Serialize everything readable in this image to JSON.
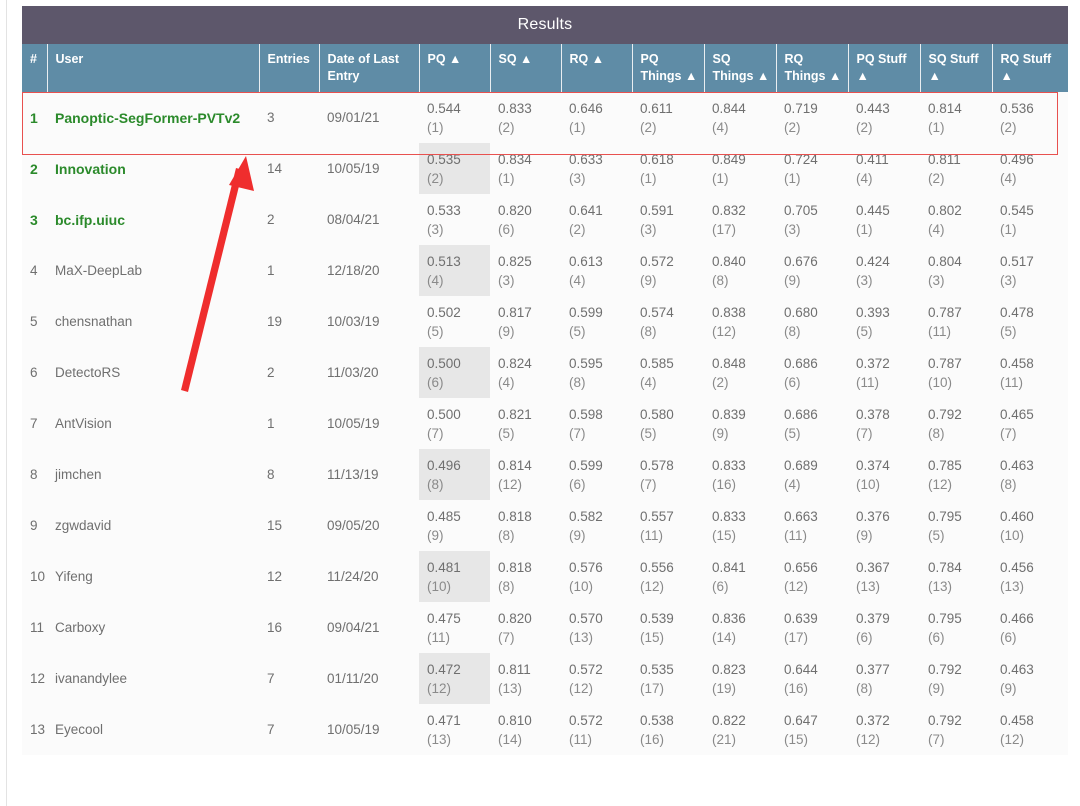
{
  "panel": {
    "title": "Results"
  },
  "table": {
    "columns": [
      {
        "key": "rank",
        "label": "#",
        "sort": ""
      },
      {
        "key": "user",
        "label": "User",
        "sort": ""
      },
      {
        "key": "entries",
        "label": "Entries",
        "sort": ""
      },
      {
        "key": "date",
        "label": "Date of Last Entry",
        "sort": ""
      },
      {
        "key": "pq",
        "label": "PQ",
        "sort": "▲"
      },
      {
        "key": "sq",
        "label": "SQ",
        "sort": "▲"
      },
      {
        "key": "rq",
        "label": "RQ",
        "sort": "▲"
      },
      {
        "key": "pq_things",
        "label": "PQ Things",
        "sort": "▲"
      },
      {
        "key": "sq_things",
        "label": "SQ Things",
        "sort": "▲"
      },
      {
        "key": "rq_things",
        "label": "RQ Things",
        "sort": "▲"
      },
      {
        "key": "pq_stuff",
        "label": "PQ Stuff",
        "sort": "▲"
      },
      {
        "key": "sq_stuff",
        "label": "SQ Stuff",
        "sort": "▲"
      },
      {
        "key": "rq_stuff",
        "label": "RQ Stuff",
        "sort": "▲"
      }
    ],
    "rows": [
      {
        "rank": "1",
        "user": "Panoptic-SegFormer-PVTv2",
        "entries": "3",
        "date": "09/01/21",
        "metrics": [
          {
            "value": "0.544",
            "rank": "(1)"
          },
          {
            "value": "0.833",
            "rank": "(2)"
          },
          {
            "value": "0.646",
            "rank": "(1)"
          },
          {
            "value": "0.611",
            "rank": "(2)"
          },
          {
            "value": "0.844",
            "rank": "(4)"
          },
          {
            "value": "0.719",
            "rank": "(2)"
          },
          {
            "value": "0.443",
            "rank": "(2)"
          },
          {
            "value": "0.814",
            "rank": "(1)"
          },
          {
            "value": "0.536",
            "rank": "(2)"
          }
        ]
      },
      {
        "rank": "2",
        "user": "Innovation",
        "entries": "14",
        "date": "10/05/19",
        "metrics": [
          {
            "value": "0.535",
            "rank": "(2)"
          },
          {
            "value": "0.834",
            "rank": "(1)"
          },
          {
            "value": "0.633",
            "rank": "(3)"
          },
          {
            "value": "0.618",
            "rank": "(1)"
          },
          {
            "value": "0.849",
            "rank": "(1)"
          },
          {
            "value": "0.724",
            "rank": "(1)"
          },
          {
            "value": "0.411",
            "rank": "(4)"
          },
          {
            "value": "0.811",
            "rank": "(2)"
          },
          {
            "value": "0.496",
            "rank": "(4)"
          }
        ]
      },
      {
        "rank": "3",
        "user": "bc.ifp.uiuc",
        "entries": "2",
        "date": "08/04/21",
        "metrics": [
          {
            "value": "0.533",
            "rank": "(3)"
          },
          {
            "value": "0.820",
            "rank": "(6)"
          },
          {
            "value": "0.641",
            "rank": "(2)"
          },
          {
            "value": "0.591",
            "rank": "(3)"
          },
          {
            "value": "0.832",
            "rank": "(17)"
          },
          {
            "value": "0.705",
            "rank": "(3)"
          },
          {
            "value": "0.445",
            "rank": "(1)"
          },
          {
            "value": "0.802",
            "rank": "(4)"
          },
          {
            "value": "0.545",
            "rank": "(1)"
          }
        ]
      },
      {
        "rank": "4",
        "user": "MaX-DeepLab",
        "entries": "1",
        "date": "12/18/20",
        "metrics": [
          {
            "value": "0.513",
            "rank": "(4)"
          },
          {
            "value": "0.825",
            "rank": "(3)"
          },
          {
            "value": "0.613",
            "rank": "(4)"
          },
          {
            "value": "0.572",
            "rank": "(9)"
          },
          {
            "value": "0.840",
            "rank": "(8)"
          },
          {
            "value": "0.676",
            "rank": "(9)"
          },
          {
            "value": "0.424",
            "rank": "(3)"
          },
          {
            "value": "0.804",
            "rank": "(3)"
          },
          {
            "value": "0.517",
            "rank": "(3)"
          }
        ]
      },
      {
        "rank": "5",
        "user": "chensnathan",
        "entries": "19",
        "date": "10/03/19",
        "metrics": [
          {
            "value": "0.502",
            "rank": "(5)"
          },
          {
            "value": "0.817",
            "rank": "(9)"
          },
          {
            "value": "0.599",
            "rank": "(5)"
          },
          {
            "value": "0.574",
            "rank": "(8)"
          },
          {
            "value": "0.838",
            "rank": "(12)"
          },
          {
            "value": "0.680",
            "rank": "(8)"
          },
          {
            "value": "0.393",
            "rank": "(5)"
          },
          {
            "value": "0.787",
            "rank": "(11)"
          },
          {
            "value": "0.478",
            "rank": "(5)"
          }
        ]
      },
      {
        "rank": "6",
        "user": "DetectoRS",
        "entries": "2",
        "date": "11/03/20",
        "metrics": [
          {
            "value": "0.500",
            "rank": "(6)"
          },
          {
            "value": "0.824",
            "rank": "(4)"
          },
          {
            "value": "0.595",
            "rank": "(8)"
          },
          {
            "value": "0.585",
            "rank": "(4)"
          },
          {
            "value": "0.848",
            "rank": "(2)"
          },
          {
            "value": "0.686",
            "rank": "(6)"
          },
          {
            "value": "0.372",
            "rank": "(11)"
          },
          {
            "value": "0.787",
            "rank": "(10)"
          },
          {
            "value": "0.458",
            "rank": "(11)"
          }
        ]
      },
      {
        "rank": "7",
        "user": "AntVision",
        "entries": "1",
        "date": "10/05/19",
        "metrics": [
          {
            "value": "0.500",
            "rank": "(7)"
          },
          {
            "value": "0.821",
            "rank": "(5)"
          },
          {
            "value": "0.598",
            "rank": "(7)"
          },
          {
            "value": "0.580",
            "rank": "(5)"
          },
          {
            "value": "0.839",
            "rank": "(9)"
          },
          {
            "value": "0.686",
            "rank": "(5)"
          },
          {
            "value": "0.378",
            "rank": "(7)"
          },
          {
            "value": "0.792",
            "rank": "(8)"
          },
          {
            "value": "0.465",
            "rank": "(7)"
          }
        ]
      },
      {
        "rank": "8",
        "user": "jimchen",
        "entries": "8",
        "date": "11/13/19",
        "metrics": [
          {
            "value": "0.496",
            "rank": "(8)"
          },
          {
            "value": "0.814",
            "rank": "(12)"
          },
          {
            "value": "0.599",
            "rank": "(6)"
          },
          {
            "value": "0.578",
            "rank": "(7)"
          },
          {
            "value": "0.833",
            "rank": "(16)"
          },
          {
            "value": "0.689",
            "rank": "(4)"
          },
          {
            "value": "0.374",
            "rank": "(10)"
          },
          {
            "value": "0.785",
            "rank": "(12)"
          },
          {
            "value": "0.463",
            "rank": "(8)"
          }
        ]
      },
      {
        "rank": "9",
        "user": "zgwdavid",
        "entries": "15",
        "date": "09/05/20",
        "metrics": [
          {
            "value": "0.485",
            "rank": "(9)"
          },
          {
            "value": "0.818",
            "rank": "(8)"
          },
          {
            "value": "0.582",
            "rank": "(9)"
          },
          {
            "value": "0.557",
            "rank": "(11)"
          },
          {
            "value": "0.833",
            "rank": "(15)"
          },
          {
            "value": "0.663",
            "rank": "(11)"
          },
          {
            "value": "0.376",
            "rank": "(9)"
          },
          {
            "value": "0.795",
            "rank": "(5)"
          },
          {
            "value": "0.460",
            "rank": "(10)"
          }
        ]
      },
      {
        "rank": "10",
        "user": "Yifeng",
        "entries": "12",
        "date": "11/24/20",
        "metrics": [
          {
            "value": "0.481",
            "rank": "(10)"
          },
          {
            "value": "0.818",
            "rank": "(8)"
          },
          {
            "value": "0.576",
            "rank": "(10)"
          },
          {
            "value": "0.556",
            "rank": "(12)"
          },
          {
            "value": "0.841",
            "rank": "(6)"
          },
          {
            "value": "0.656",
            "rank": "(12)"
          },
          {
            "value": "0.367",
            "rank": "(13)"
          },
          {
            "value": "0.784",
            "rank": "(13)"
          },
          {
            "value": "0.456",
            "rank": "(13)"
          }
        ]
      },
      {
        "rank": "11",
        "user": "Carboxy",
        "entries": "16",
        "date": "09/04/21",
        "metrics": [
          {
            "value": "0.475",
            "rank": "(11)"
          },
          {
            "value": "0.820",
            "rank": "(7)"
          },
          {
            "value": "0.570",
            "rank": "(13)"
          },
          {
            "value": "0.539",
            "rank": "(15)"
          },
          {
            "value": "0.836",
            "rank": "(14)"
          },
          {
            "value": "0.639",
            "rank": "(17)"
          },
          {
            "value": "0.379",
            "rank": "(6)"
          },
          {
            "value": "0.795",
            "rank": "(6)"
          },
          {
            "value": "0.466",
            "rank": "(6)"
          }
        ]
      },
      {
        "rank": "12",
        "user": "ivanandylee",
        "entries": "7",
        "date": "01/11/20",
        "metrics": [
          {
            "value": "0.472",
            "rank": "(12)"
          },
          {
            "value": "0.811",
            "rank": "(13)"
          },
          {
            "value": "0.572",
            "rank": "(12)"
          },
          {
            "value": "0.535",
            "rank": "(17)"
          },
          {
            "value": "0.823",
            "rank": "(19)"
          },
          {
            "value": "0.644",
            "rank": "(16)"
          },
          {
            "value": "0.377",
            "rank": "(8)"
          },
          {
            "value": "0.792",
            "rank": "(9)"
          },
          {
            "value": "0.463",
            "rank": "(9)"
          }
        ]
      },
      {
        "rank": "13",
        "user": "Eyecool",
        "entries": "7",
        "date": "10/05/19",
        "metrics": [
          {
            "value": "0.471",
            "rank": "(13)"
          },
          {
            "value": "0.810",
            "rank": "(14)"
          },
          {
            "value": "0.572",
            "rank": "(11)"
          },
          {
            "value": "0.538",
            "rank": "(16)"
          },
          {
            "value": "0.822",
            "rank": "(21)"
          },
          {
            "value": "0.647",
            "rank": "(15)"
          },
          {
            "value": "0.372",
            "rank": "(12)"
          },
          {
            "value": "0.792",
            "rank": "(7)"
          },
          {
            "value": "0.458",
            "rank": "(12)"
          }
        ]
      }
    ],
    "top_rank_count": 3,
    "shaded_metric_column": 0
  },
  "annotations": {
    "highlight_rect": {
      "target_row_rank": "1",
      "color": "#e8514f"
    },
    "arrow": {
      "color": "#ef2d2d",
      "points_to_row_rank": "1"
    }
  }
}
